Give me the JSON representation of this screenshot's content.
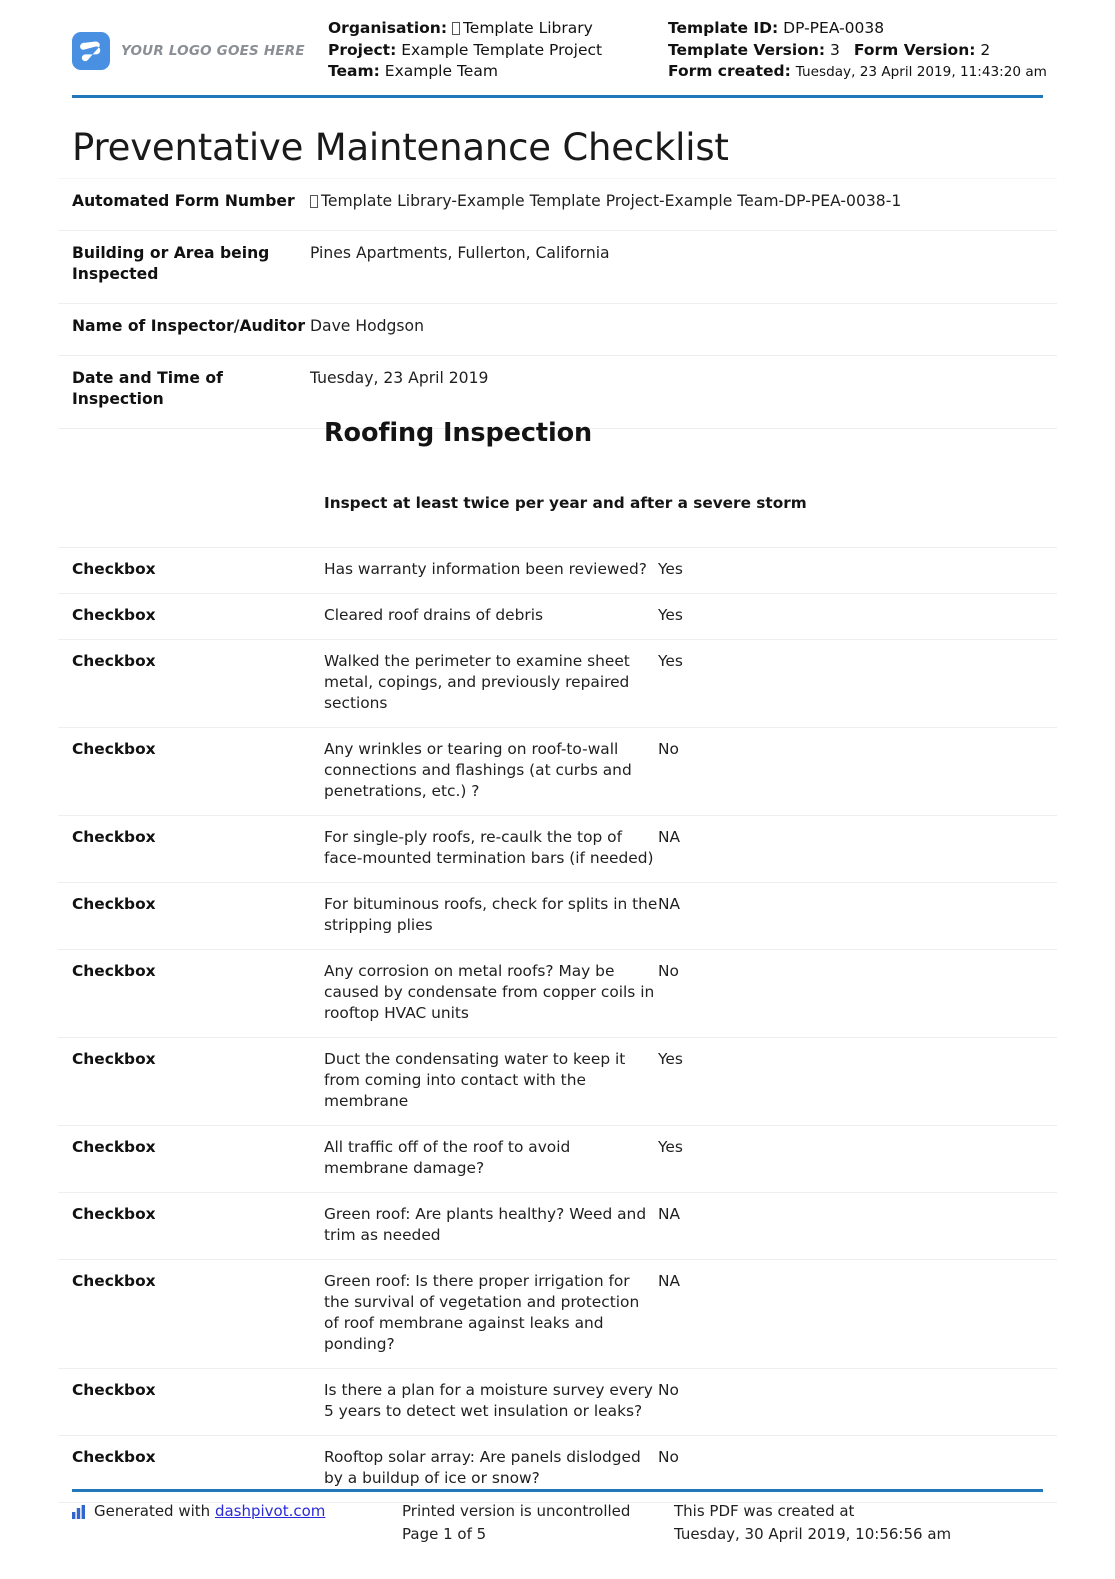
{
  "header": {
    "logo_alt_text": "YOUR LOGO GOES HERE",
    "left": {
      "organisation_label": "Organisation:",
      "organisation_value": "Template Library",
      "project_label": "Project:",
      "project_value": "Example Template Project",
      "team_label": "Team:",
      "team_value": "Example Team"
    },
    "right": {
      "template_id_label": "Template ID:",
      "template_id_value": "DP-PEA-0038",
      "template_version_label": "Template Version:",
      "template_version_value": "3",
      "form_version_label": "Form Version:",
      "form_version_value": "2",
      "form_created_label": "Form created:",
      "form_created_value": "Tuesday, 23 April 2019, 11:43:20 am"
    }
  },
  "title": "Preventative Maintenance Checklist",
  "info_fields": [
    {
      "label": "Automated Form Number",
      "value": "Template Library-Example Template Project-Example Team-DP-PEA-0038-1",
      "has_tofu": true
    },
    {
      "label": "Building or Area being Inspected",
      "value": "Pines Apartments, Fullerton, California",
      "has_tofu": false
    },
    {
      "label": "Name of Inspector/Auditor",
      "value": "Dave Hodgson",
      "has_tofu": false
    },
    {
      "label": "Date and Time of Inspection",
      "value": "Tuesday, 23 April 2019",
      "has_tofu": false
    }
  ],
  "section": {
    "heading": "Roofing Inspection",
    "note": "Inspect at least twice per year and after a severe storm"
  },
  "checklist": {
    "rows": [
      {
        "type": "Checkbox",
        "question": "Has warranty information been reviewed?",
        "answer": "Yes"
      },
      {
        "type": "Checkbox",
        "question": "Cleared roof drains of debris",
        "answer": "Yes"
      },
      {
        "type": "Checkbox",
        "question": "Walked the perimeter to examine sheet metal, copings, and previously repaired sections",
        "answer": "Yes"
      },
      {
        "type": "Checkbox",
        "question": "Any wrinkles or tearing on roof-to-wall connections and flashings (at curbs and penetrations, etc.) ?",
        "answer": "No"
      },
      {
        "type": "Checkbox",
        "question": "For single-ply roofs, re-caulk the top of face-mounted termination bars (if needed)",
        "answer": "NA"
      },
      {
        "type": "Checkbox",
        "question": "For bituminous roofs, check for splits in the stripping plies",
        "answer": "NA"
      },
      {
        "type": "Checkbox",
        "question": "Any corrosion on metal roofs? May be caused by condensate from copper coils in rooftop HVAC units",
        "answer": "No"
      },
      {
        "type": "Checkbox",
        "question": "Duct the condensating water to keep it from coming into contact with the membrane",
        "answer": "Yes"
      },
      {
        "type": "Checkbox",
        "question": "All traffic off of the roof to avoid membrane damage?",
        "answer": "Yes"
      },
      {
        "type": "Checkbox",
        "question": "Green roof: Are plants healthy? Weed and trim as needed",
        "answer": "NA"
      },
      {
        "type": "Checkbox",
        "question": "Green roof: Is there proper irrigation for the survival of vegetation and protection of roof membrane against leaks and ponding?",
        "answer": "NA"
      },
      {
        "type": "Checkbox",
        "question": "Is there a plan for a moisture survey every 5 years to detect wet insulation or leaks?",
        "answer": "No"
      },
      {
        "type": "Checkbox",
        "question": "Rooftop solar array: Are panels dislodged by a buildup of ice or snow?",
        "answer": "No"
      }
    ]
  },
  "footer": {
    "generated_prefix": "Generated with",
    "generated_link": "dashpivot.com",
    "print_notice": "Printed version is uncontrolled",
    "page_number": "Page 1 of 5",
    "created_label": "This PDF was created at",
    "created_value": "Tuesday, 30 April 2019, 10:56:56 am"
  },
  "colors": {
    "accent_blue": "#2277bb",
    "logo_blue": "#4a90e2",
    "link_blue": "#2a2ad8",
    "row_divider": "#eceef0"
  }
}
